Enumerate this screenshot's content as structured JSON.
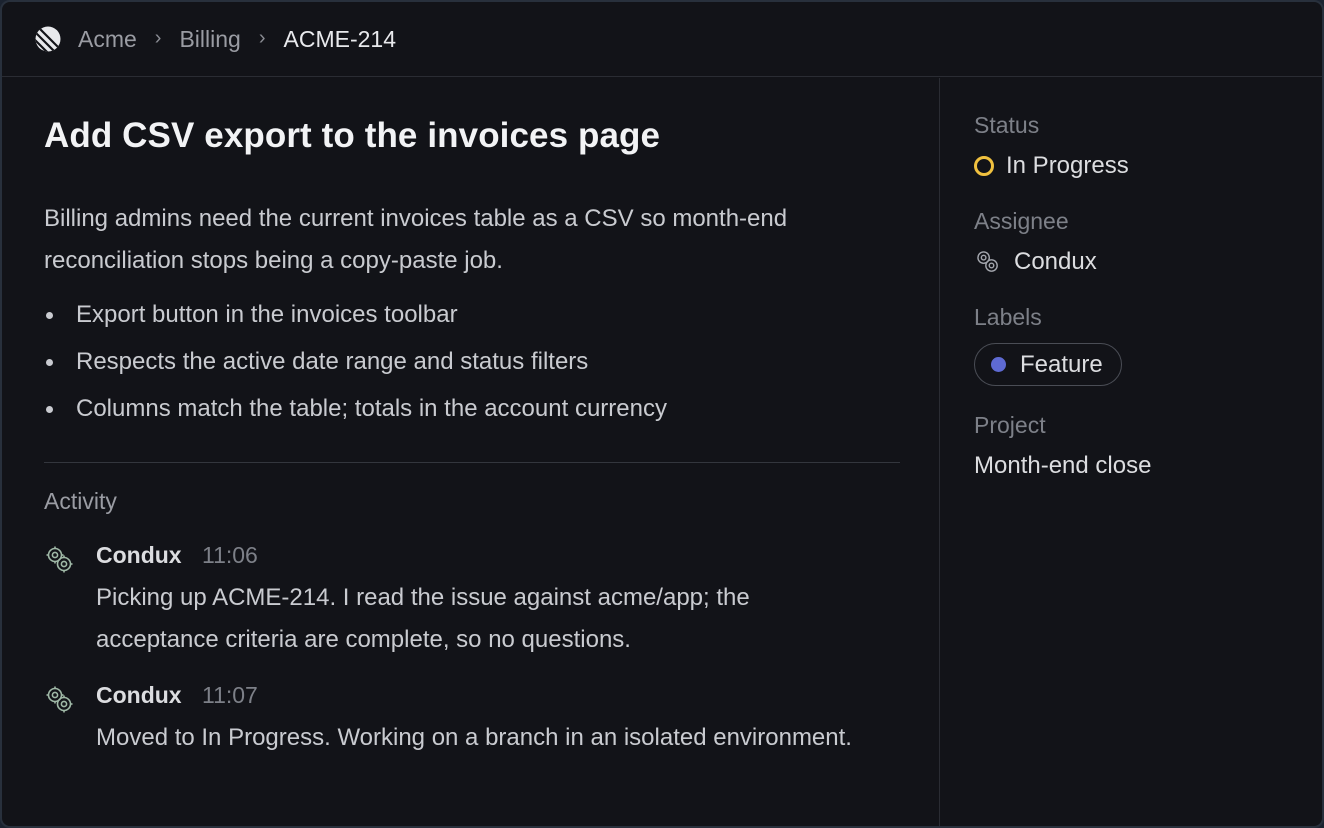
{
  "breadcrumb": {
    "items": [
      "Acme",
      "Billing",
      "ACME-214"
    ],
    "separator": "›"
  },
  "issue": {
    "title": "Add CSV export to the invoices page",
    "description": "Billing admins need the current invoices table as a CSV so month-end reconciliation stops being a copy-paste job.",
    "criteria": [
      "Export button in the invoices toolbar",
      "Respects the active date range and status filters",
      "Columns match the table; totals in the account currency"
    ]
  },
  "activity": {
    "heading": "Activity",
    "items": [
      {
        "author": "Condux",
        "time": "11:06",
        "message": "Picking up ACME-214. I read the issue against acme/app; the acceptance criteria are complete, so no questions."
      },
      {
        "author": "Condux",
        "time": "11:07",
        "message": "Moved to In Progress. Working on a branch in an isolated environment."
      }
    ]
  },
  "properties": {
    "status_label": "Status",
    "status_value": "In Progress",
    "status_color": "#f0c13f",
    "assignee_label": "Assignee",
    "assignee_value": "Condux",
    "labels_label": "Labels",
    "label_value": "Feature",
    "label_color": "#5e6ad2",
    "project_label": "Project",
    "project_value": "Month-end close"
  },
  "icons": {
    "app_logo": "linear-logo-icon",
    "agent_avatar": "bot-gears-icon",
    "status": "in-progress-ring-icon"
  }
}
